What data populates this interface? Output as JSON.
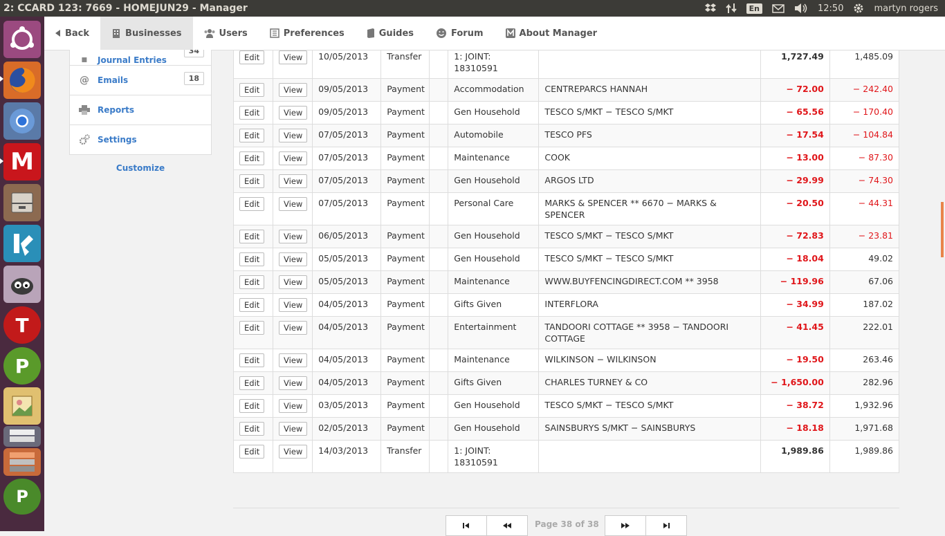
{
  "topbar": {
    "window_title": "2: CCARD 123: 7669 - HOMEJUN29 - Manager",
    "lang": "En",
    "time": "12:50",
    "user": "martyn rogers"
  },
  "nav": {
    "back": "Back",
    "businesses": "Businesses",
    "users": "Users",
    "preferences": "Preferences",
    "guides": "Guides",
    "forum": "Forum",
    "about": "About Manager"
  },
  "sidebar": {
    "items": [
      {
        "label": "Journal Entries",
        "count": "34"
      },
      {
        "label": "Emails",
        "count": "18"
      },
      {
        "label": "Reports"
      },
      {
        "label": "Settings"
      }
    ],
    "customize": "Customize"
  },
  "table": {
    "edit_label": "Edit",
    "view_label": "View",
    "rows": [
      {
        "date": "10/05/2013",
        "type": "Transfer",
        "account": "1: JOINT: 18310591",
        "description": "",
        "amount": "1,727.49",
        "balance": "1,485.09"
      },
      {
        "date": "09/05/2013",
        "type": "Payment",
        "account": "Accommodation",
        "description": "CENTREPARCS HANNAH",
        "amount": "− 72.00",
        "balance": "− 242.40"
      },
      {
        "date": "09/05/2013",
        "type": "Payment",
        "account": "Gen Household",
        "description": "TESCO S/MKT − TESCO S/MKT",
        "amount": "− 65.56",
        "balance": "− 170.40"
      },
      {
        "date": "07/05/2013",
        "type": "Payment",
        "account": "Automobile",
        "description": "TESCO PFS",
        "amount": "− 17.54",
        "balance": "− 104.84"
      },
      {
        "date": "07/05/2013",
        "type": "Payment",
        "account": "Maintenance",
        "description": "COOK",
        "amount": "− 13.00",
        "balance": "− 87.30"
      },
      {
        "date": "07/05/2013",
        "type": "Payment",
        "account": "Gen Household",
        "description": "ARGOS LTD",
        "amount": "− 29.99",
        "balance": "− 74.30"
      },
      {
        "date": "07/05/2013",
        "type": "Payment",
        "account": "Personal Care",
        "description": "MARKS & SPENCER ** 6670 − MARKS & SPENCER",
        "amount": "− 20.50",
        "balance": "− 44.31"
      },
      {
        "date": "06/05/2013",
        "type": "Payment",
        "account": "Gen Household",
        "description": "TESCO S/MKT − TESCO S/MKT",
        "amount": "− 72.83",
        "balance": "− 23.81"
      },
      {
        "date": "05/05/2013",
        "type": "Payment",
        "account": "Gen Household",
        "description": "TESCO S/MKT − TESCO S/MKT",
        "amount": "− 18.04",
        "balance": "49.02"
      },
      {
        "date": "05/05/2013",
        "type": "Payment",
        "account": "Maintenance",
        "description": "WWW.BUYFENCINGDIRECT.COM ** 3958",
        "amount": "− 119.96",
        "balance": "67.06"
      },
      {
        "date": "04/05/2013",
        "type": "Payment",
        "account": "Gifts Given",
        "description": "INTERFLORA",
        "amount": "− 34.99",
        "balance": "187.02"
      },
      {
        "date": "04/05/2013",
        "type": "Payment",
        "account": "Entertainment",
        "description": "TANDOORI COTTAGE ** 3958 − TANDOORI COTTAGE",
        "amount": "− 41.45",
        "balance": "222.01"
      },
      {
        "date": "04/05/2013",
        "type": "Payment",
        "account": "Maintenance",
        "description": "WILKINSON − WILKINSON",
        "amount": "− 19.50",
        "balance": "263.46"
      },
      {
        "date": "04/05/2013",
        "type": "Payment",
        "account": "Gifts Given",
        "description": "CHARLES TURNEY & CO",
        "amount": "− 1,650.00",
        "balance": "282.96"
      },
      {
        "date": "03/05/2013",
        "type": "Payment",
        "account": "Gen Household",
        "description": "TESCO S/MKT − TESCO S/MKT",
        "amount": "− 38.72",
        "balance": "1,932.96"
      },
      {
        "date": "02/05/2013",
        "type": "Payment",
        "account": "Gen Household",
        "description": "SAINSBURYS S/MKT − SAINSBURYS",
        "amount": "− 18.18",
        "balance": "1,971.68"
      },
      {
        "date": "14/03/2013",
        "type": "Transfer",
        "account": "1: JOINT: 18310591",
        "description": "",
        "amount": "1,989.86",
        "balance": "1,989.86"
      }
    ]
  },
  "pager": {
    "text": "Page 38 of 38"
  },
  "launcher": {
    "icons": [
      "ubuntu-dash-icon",
      "firefox-icon",
      "chromium-icon",
      "manager-icon",
      "files-icon",
      "kodi-icon",
      "ghost-app-icon",
      "t-app-icon",
      "p-app-icon",
      "image-viewer-icon",
      "pdf-shuffler-icon",
      "app-stack-icon"
    ],
    "labels": {
      "manager": "M",
      "t_app": "T",
      "p_app": "P"
    }
  },
  "colors": {
    "negative": "#e0161a",
    "link": "#3a7bc8",
    "launcher_bg": "#4a2a3f",
    "topbar_bg": "#3c3b37",
    "scroll_accent": "#e8844a"
  }
}
